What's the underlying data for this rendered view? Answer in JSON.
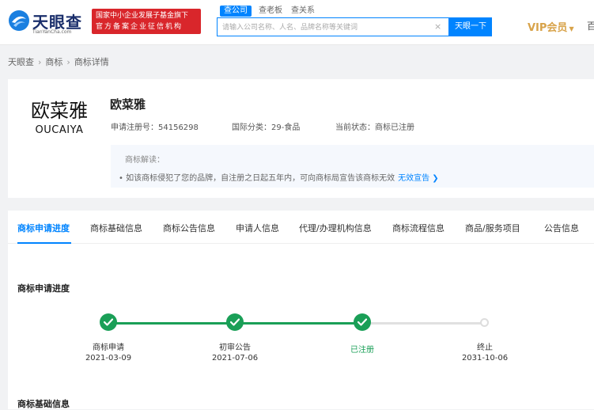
{
  "header": {
    "logo_cn": "天眼查",
    "logo_en": "TianYanCha.com",
    "badge_line1": "国家中小企业发展子基金旗下",
    "badge_line2": "官方备案企业征信机构",
    "search_tabs": [
      "查公司",
      "查老板",
      "查关系"
    ],
    "search_placeholder": "请输入公司名称、人名、品牌名称等关键词",
    "search_clear": "×",
    "search_button": "天眼一下",
    "vip_label": "VIP会员",
    "vip_caret": "▼",
    "edge_text": "百"
  },
  "breadcrumb": [
    "天眼查",
    "商标",
    "商标详情"
  ],
  "trademark": {
    "logo_cn": "欧菜雅",
    "logo_en": "OUCAIYA",
    "name": "欧菜雅",
    "reg_no": "申请注册号：54156298",
    "category": "国际分类：29-食品",
    "status": "当前状态：商标已注册",
    "interp_title": "商标解读：",
    "interp_text": "• 如该商标侵犯了您的品牌，自注册之日起五年内，可向商标局宣告该商标无效",
    "interp_link": "无效宣告 ❯"
  },
  "tabs": [
    "商标申请进度",
    "商标基础信息",
    "商标公告信息",
    "申请人信息",
    "代理/办理机构信息",
    "商标流程信息",
    "商品/服务项目",
    "公告信息"
  ],
  "progress": {
    "title": "商标申请进度",
    "steps": [
      {
        "label": "商标申请",
        "date": "2021-03-09",
        "status": "done"
      },
      {
        "label": "初审公告",
        "date": "2021-07-06",
        "status": "done"
      },
      {
        "label": "已注册",
        "date": "",
        "status": "current"
      },
      {
        "label": "终止",
        "date": "2031-10-06",
        "status": "pending"
      }
    ]
  },
  "basic_info_title": "商标基础信息",
  "colors": {
    "accent": "#0084ff",
    "success": "#1a9f57",
    "brand_red": "#d9262b",
    "vip": "#d8a34a"
  }
}
